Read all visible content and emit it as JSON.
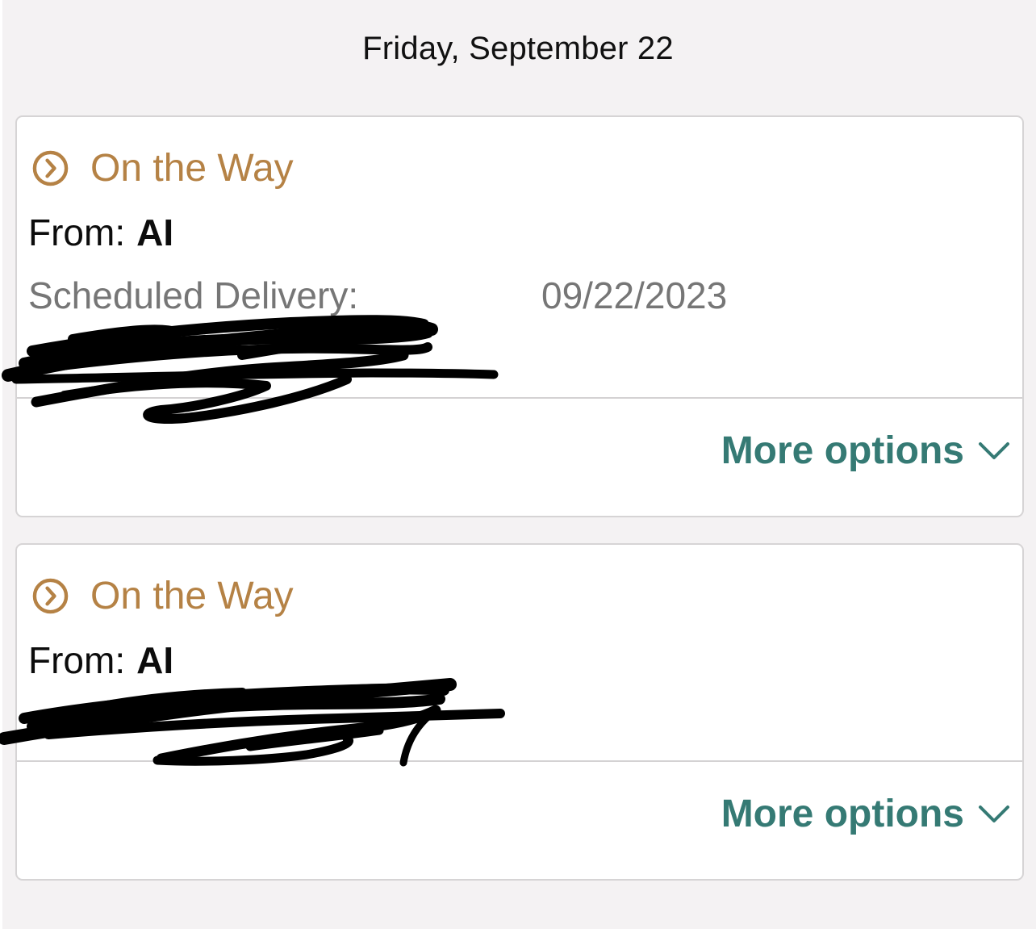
{
  "header": {
    "date": "Friday, September 22"
  },
  "deliveries": [
    {
      "status": "On the Way",
      "status_icon": "chevron-right-circle-icon",
      "from_label": "From:",
      "from_value": "AI",
      "scheduled_label": "Scheduled Delivery:",
      "scheduled_date": "09/22/2023",
      "tracking_number": "",
      "more_options_label": "More options"
    },
    {
      "status": "On the Way",
      "status_icon": "chevron-right-circle-icon",
      "from_label": "From:",
      "from_value": "AI",
      "tracking_number": "",
      "more_options_label": "More options"
    }
  ],
  "colors": {
    "background": "#f4f2f3",
    "card": "#ffffff",
    "status": "#b58245",
    "link": "#357a74",
    "secondary_text": "#767676"
  }
}
